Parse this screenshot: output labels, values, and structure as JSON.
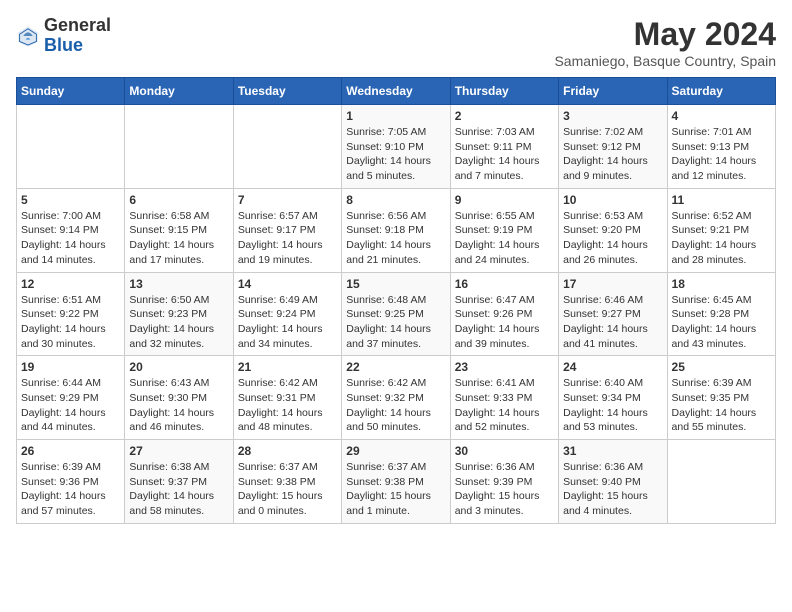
{
  "header": {
    "logo_general": "General",
    "logo_blue": "Blue",
    "month_title": "May 2024",
    "subtitle": "Samaniego, Basque Country, Spain"
  },
  "weekdays": [
    "Sunday",
    "Monday",
    "Tuesday",
    "Wednesday",
    "Thursday",
    "Friday",
    "Saturday"
  ],
  "weeks": [
    [
      {
        "day": "",
        "info": ""
      },
      {
        "day": "",
        "info": ""
      },
      {
        "day": "",
        "info": ""
      },
      {
        "day": "1",
        "info": "Sunrise: 7:05 AM\nSunset: 9:10 PM\nDaylight: 14 hours\nand 5 minutes."
      },
      {
        "day": "2",
        "info": "Sunrise: 7:03 AM\nSunset: 9:11 PM\nDaylight: 14 hours\nand 7 minutes."
      },
      {
        "day": "3",
        "info": "Sunrise: 7:02 AM\nSunset: 9:12 PM\nDaylight: 14 hours\nand 9 minutes."
      },
      {
        "day": "4",
        "info": "Sunrise: 7:01 AM\nSunset: 9:13 PM\nDaylight: 14 hours\nand 12 minutes."
      }
    ],
    [
      {
        "day": "5",
        "info": "Sunrise: 7:00 AM\nSunset: 9:14 PM\nDaylight: 14 hours\nand 14 minutes."
      },
      {
        "day": "6",
        "info": "Sunrise: 6:58 AM\nSunset: 9:15 PM\nDaylight: 14 hours\nand 17 minutes."
      },
      {
        "day": "7",
        "info": "Sunrise: 6:57 AM\nSunset: 9:17 PM\nDaylight: 14 hours\nand 19 minutes."
      },
      {
        "day": "8",
        "info": "Sunrise: 6:56 AM\nSunset: 9:18 PM\nDaylight: 14 hours\nand 21 minutes."
      },
      {
        "day": "9",
        "info": "Sunrise: 6:55 AM\nSunset: 9:19 PM\nDaylight: 14 hours\nand 24 minutes."
      },
      {
        "day": "10",
        "info": "Sunrise: 6:53 AM\nSunset: 9:20 PM\nDaylight: 14 hours\nand 26 minutes."
      },
      {
        "day": "11",
        "info": "Sunrise: 6:52 AM\nSunset: 9:21 PM\nDaylight: 14 hours\nand 28 minutes."
      }
    ],
    [
      {
        "day": "12",
        "info": "Sunrise: 6:51 AM\nSunset: 9:22 PM\nDaylight: 14 hours\nand 30 minutes."
      },
      {
        "day": "13",
        "info": "Sunrise: 6:50 AM\nSunset: 9:23 PM\nDaylight: 14 hours\nand 32 minutes."
      },
      {
        "day": "14",
        "info": "Sunrise: 6:49 AM\nSunset: 9:24 PM\nDaylight: 14 hours\nand 34 minutes."
      },
      {
        "day": "15",
        "info": "Sunrise: 6:48 AM\nSunset: 9:25 PM\nDaylight: 14 hours\nand 37 minutes."
      },
      {
        "day": "16",
        "info": "Sunrise: 6:47 AM\nSunset: 9:26 PM\nDaylight: 14 hours\nand 39 minutes."
      },
      {
        "day": "17",
        "info": "Sunrise: 6:46 AM\nSunset: 9:27 PM\nDaylight: 14 hours\nand 41 minutes."
      },
      {
        "day": "18",
        "info": "Sunrise: 6:45 AM\nSunset: 9:28 PM\nDaylight: 14 hours\nand 43 minutes."
      }
    ],
    [
      {
        "day": "19",
        "info": "Sunrise: 6:44 AM\nSunset: 9:29 PM\nDaylight: 14 hours\nand 44 minutes."
      },
      {
        "day": "20",
        "info": "Sunrise: 6:43 AM\nSunset: 9:30 PM\nDaylight: 14 hours\nand 46 minutes."
      },
      {
        "day": "21",
        "info": "Sunrise: 6:42 AM\nSunset: 9:31 PM\nDaylight: 14 hours\nand 48 minutes."
      },
      {
        "day": "22",
        "info": "Sunrise: 6:42 AM\nSunset: 9:32 PM\nDaylight: 14 hours\nand 50 minutes."
      },
      {
        "day": "23",
        "info": "Sunrise: 6:41 AM\nSunset: 9:33 PM\nDaylight: 14 hours\nand 52 minutes."
      },
      {
        "day": "24",
        "info": "Sunrise: 6:40 AM\nSunset: 9:34 PM\nDaylight: 14 hours\nand 53 minutes."
      },
      {
        "day": "25",
        "info": "Sunrise: 6:39 AM\nSunset: 9:35 PM\nDaylight: 14 hours\nand 55 minutes."
      }
    ],
    [
      {
        "day": "26",
        "info": "Sunrise: 6:39 AM\nSunset: 9:36 PM\nDaylight: 14 hours\nand 57 minutes."
      },
      {
        "day": "27",
        "info": "Sunrise: 6:38 AM\nSunset: 9:37 PM\nDaylight: 14 hours\nand 58 minutes."
      },
      {
        "day": "28",
        "info": "Sunrise: 6:37 AM\nSunset: 9:38 PM\nDaylight: 15 hours\nand 0 minutes."
      },
      {
        "day": "29",
        "info": "Sunrise: 6:37 AM\nSunset: 9:38 PM\nDaylight: 15 hours\nand 1 minute."
      },
      {
        "day": "30",
        "info": "Sunrise: 6:36 AM\nSunset: 9:39 PM\nDaylight: 15 hours\nand 3 minutes."
      },
      {
        "day": "31",
        "info": "Sunrise: 6:36 AM\nSunset: 9:40 PM\nDaylight: 15 hours\nand 4 minutes."
      },
      {
        "day": "",
        "info": ""
      }
    ]
  ]
}
